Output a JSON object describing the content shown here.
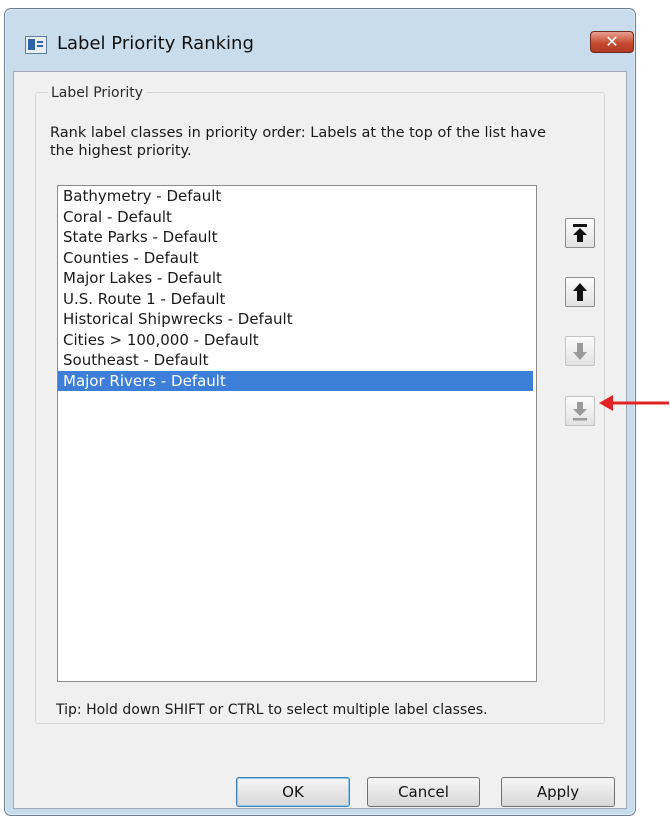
{
  "window": {
    "title": "Label Priority Ranking",
    "close_glyph": "✕"
  },
  "group": {
    "legend": "Label Priority",
    "description": "Rank label classes in priority order: Labels at the top of the list have the highest priority."
  },
  "list": {
    "items": [
      "Bathymetry - Default",
      "Coral - Default",
      "State Parks - Default",
      "Counties - Default",
      "Major Lakes - Default",
      "U.S. Route 1 - Default",
      "Historical Shipwrecks - Default",
      "Cities > 100,000 - Default",
      "Southeast - Default",
      "Major Rivers - Default"
    ],
    "selected_index": 9
  },
  "move_buttons": [
    {
      "icon": "move-to-top-icon",
      "enabled": true
    },
    {
      "icon": "move-up-icon",
      "enabled": true
    },
    {
      "icon": "move-down-icon",
      "enabled": false
    },
    {
      "icon": "move-to-bottom-icon",
      "enabled": false
    }
  ],
  "tip": "Tip: Hold down SHIFT or CTRL to select multiple label classes.",
  "buttons": {
    "ok": "OK",
    "cancel": "Cancel",
    "apply": "Apply"
  },
  "colors": {
    "selection": "#3d7ed8",
    "annotation_arrow": "#e02424",
    "close_button": "#c64b31"
  }
}
